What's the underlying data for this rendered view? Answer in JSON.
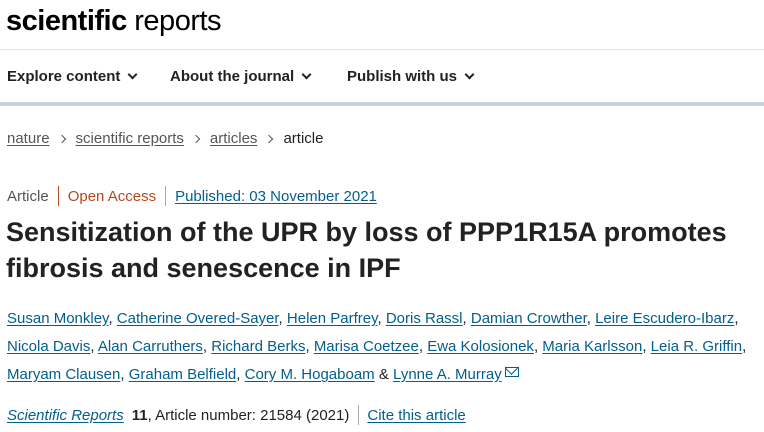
{
  "logo": {
    "bold": "scientific",
    "regular": " reports"
  },
  "nav": [
    {
      "label": "Explore content"
    },
    {
      "label": "About the journal"
    },
    {
      "label": "Publish with us"
    }
  ],
  "breadcrumb": {
    "items": [
      "nature",
      "scientific reports",
      "articles"
    ],
    "current": "article"
  },
  "meta": {
    "type": "Article",
    "access": "Open Access",
    "published": "Published: 03 November 2021"
  },
  "title": "Sensitization of the UPR by loss of PPP1R15A promotes fibrosis and senescence in IPF",
  "authors": [
    "Susan Monkley",
    "Catherine Overed-Sayer",
    "Helen Parfrey",
    "Doris Rassl",
    "Damian Crowther",
    "Leire Escudero-Ibarz",
    "Nicola Davis",
    "Alan Carruthers",
    "Richard Berks",
    "Marisa Coetzee",
    "Ewa Kolosionek",
    "Maria Karlsson",
    "Leia R. Griffin",
    "Maryam Clausen",
    "Graham Belfield",
    "Cory M. Hogaboam",
    "Lynne A. Murray"
  ],
  "authors_ampersand": "&",
  "citation": {
    "journal": "Scientific Reports",
    "volume": "11",
    "article_info": ", Article number: 21584 (2021)",
    "cite_label": "Cite this article"
  },
  "colors": {
    "link": "#025e8d",
    "open_access": "#b34a1d",
    "nav_rule": "#c5d3de"
  },
  "icons": {
    "nav_dropdown": "chevron-down-icon",
    "breadcrumb_sep": "chevron-right-icon",
    "corresponding_author": "mail-icon"
  }
}
